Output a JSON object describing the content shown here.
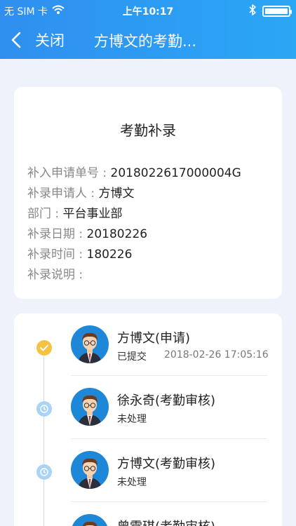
{
  "status_bar": {
    "carrier": "无 SIM 卡",
    "time": "上午10:17",
    "icons": [
      "wifi-icon",
      "bluetooth-icon",
      "battery-icon"
    ]
  },
  "nav": {
    "back_label": "关闭",
    "title": "方博文的考勤..."
  },
  "form": {
    "title": "考勤补录",
    "rows": [
      {
        "key": "补入申请单号 :",
        "value": "2018022617000004G"
      },
      {
        "key": "补录申请人 :",
        "value": "方博文"
      },
      {
        "key": "部门 :",
        "value": "平台事业部"
      },
      {
        "key": "补录日期 :",
        "value": "20180226"
      },
      {
        "key": "补录时间 :",
        "value": "180226"
      },
      {
        "key": "补录说明 :",
        "value": ""
      }
    ]
  },
  "flow": {
    "items": [
      {
        "name": "方博文(申请)",
        "status": "已提交",
        "time": "2018-02-26 17:05:16",
        "state": "done"
      },
      {
        "name": "徐永奇(考勤审核)",
        "status": "未处理",
        "time": "",
        "state": "wait"
      },
      {
        "name": "方博文(考勤审核)",
        "status": "未处理",
        "time": "",
        "state": "wait"
      },
      {
        "name": "曾雪琪(考勤审核)",
        "status": "",
        "time": "",
        "state": "wait"
      }
    ]
  },
  "colors": {
    "primary": "#2a9af3",
    "done": "#f5c242",
    "wait": "#a9d3f7",
    "background": "#eef3fb"
  }
}
